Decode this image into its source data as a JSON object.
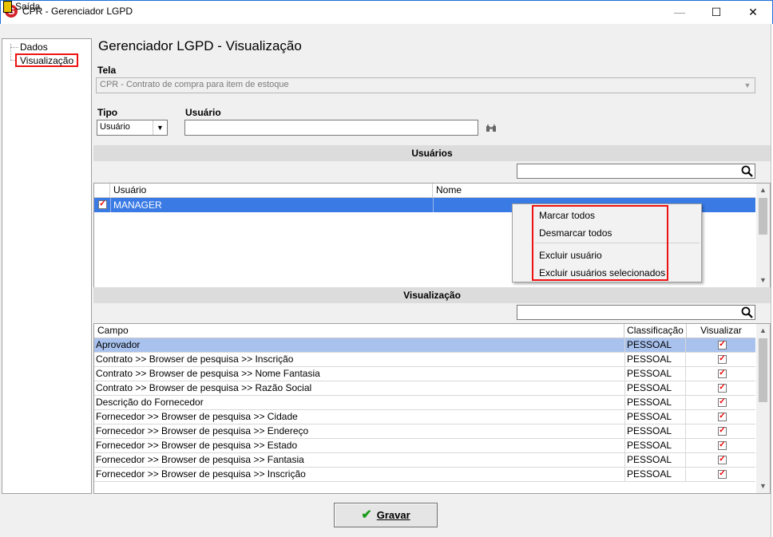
{
  "window": {
    "title": "CPR - Gerenciador LGPD",
    "app_icon_letter": "G",
    "minimize": "—",
    "maximize": "☐",
    "close": "✕"
  },
  "menu": {
    "exit": "Saída"
  },
  "tree": {
    "items": [
      "Dados",
      "Visualização"
    ],
    "selected": "Visualização"
  },
  "page": {
    "title": "Gerenciador LGPD - Visualização"
  },
  "tela": {
    "label": "Tela",
    "value": "CPR - Contrato de compra para item de estoque"
  },
  "tipo": {
    "label": "Tipo",
    "value": "Usuário"
  },
  "usuario": {
    "label": "Usuário",
    "value": ""
  },
  "usuarios_section": {
    "title": "Usuários",
    "columns": [
      "Usuário",
      "Nome"
    ],
    "rows": [
      {
        "checked": true,
        "usuario": "MANAGER",
        "nome": ""
      }
    ]
  },
  "context_menu": {
    "items": [
      "Marcar todos",
      "Desmarcar todos",
      "Excluir usuário",
      "Excluir usuários selecionados"
    ]
  },
  "vis_section": {
    "title": "Visualização",
    "columns": [
      "Campo",
      "Classificação",
      "Visualizar"
    ],
    "rows": [
      {
        "campo": "Aprovador",
        "classificacao": "PESSOAL",
        "visualizar": true
      },
      {
        "campo": "Contrato >> Browser de pesquisa >> Inscrição",
        "classificacao": "PESSOAL",
        "visualizar": true
      },
      {
        "campo": "Contrato >> Browser de pesquisa >> Nome Fantasia",
        "classificacao": "PESSOAL",
        "visualizar": true
      },
      {
        "campo": "Contrato >> Browser de pesquisa >> Razão Social",
        "classificacao": "PESSOAL",
        "visualizar": true
      },
      {
        "campo": "Descrição do Fornecedor",
        "classificacao": "PESSOAL",
        "visualizar": true
      },
      {
        "campo": "Fornecedor >> Browser de pesquisa >> Cidade",
        "classificacao": "PESSOAL",
        "visualizar": true
      },
      {
        "campo": "Fornecedor >> Browser de pesquisa >> Endereço",
        "classificacao": "PESSOAL",
        "visualizar": true
      },
      {
        "campo": "Fornecedor >> Browser de pesquisa >> Estado",
        "classificacao": "PESSOAL",
        "visualizar": true
      },
      {
        "campo": "Fornecedor >> Browser de pesquisa >> Fantasia",
        "classificacao": "PESSOAL",
        "visualizar": true
      },
      {
        "campo": "Fornecedor >> Browser de pesquisa >> Inscrição",
        "classificacao": "PESSOAL",
        "visualizar": true
      }
    ]
  },
  "save_button": {
    "label": "Gravar"
  },
  "colors": {
    "selection_blue": "#3a7ae5",
    "row_highlight": "#a8c1ed",
    "annotation_red": "#ee1111",
    "check_red": "#ee0000"
  }
}
